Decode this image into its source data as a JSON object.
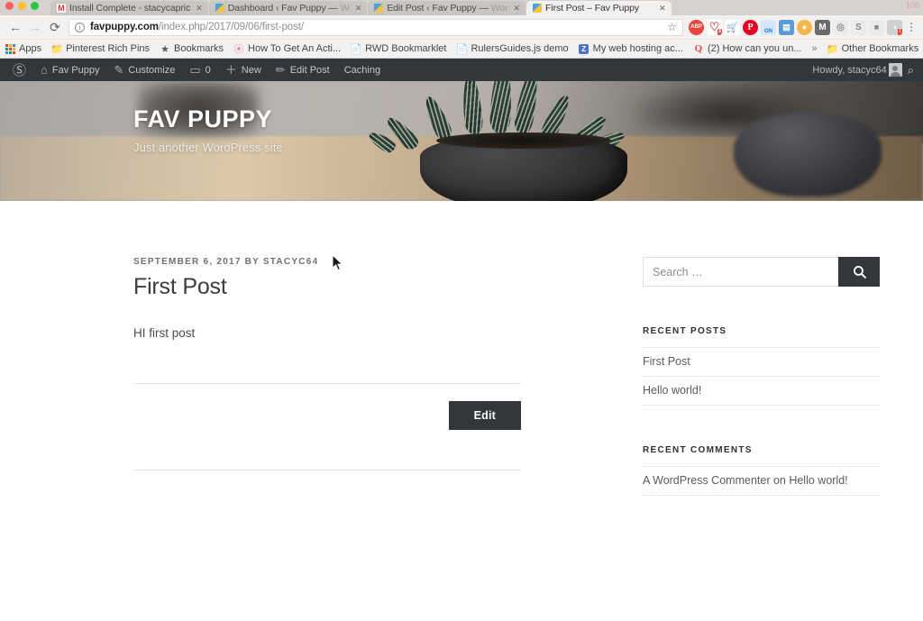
{
  "browser": {
    "tabs": [
      {
        "title": "Install Complete - stacycapric",
        "title_dim": "",
        "favicon": "gmail-icon",
        "active": false
      },
      {
        "title": "Dashboard ‹ Fav Puppy — ",
        "title_dim": "Wo",
        "favicon": "wordpress-icon",
        "active": false
      },
      {
        "title": "Edit Post ‹ Fav Puppy — ",
        "title_dim": "Wor",
        "favicon": "wordpress-icon",
        "active": false
      },
      {
        "title": "First Post – Fav Puppy",
        "title_dim": "",
        "favicon": "wordpress-icon",
        "active": true
      }
    ],
    "close_glyph": "✕",
    "nav": {
      "back": "←",
      "forward": "→",
      "reload": "⟳"
    },
    "omnibox": {
      "info_glyph": "i",
      "url_host": "favpuppy.com",
      "url_path": "/index.php/2017/09/06/first-post/",
      "star_glyph": "☆"
    },
    "extensions": [
      {
        "name": "adblock-icon",
        "glyph": "ABP"
      },
      {
        "name": "heart-icon",
        "glyph": "♡",
        "badge": "3"
      },
      {
        "name": "cart-icon",
        "glyph": "🛒"
      },
      {
        "name": "pinterest-icon",
        "glyph": "P"
      },
      {
        "name": "printer-on-icon",
        "glyph": "ON"
      },
      {
        "name": "blue-tab-icon",
        "glyph": "▤"
      },
      {
        "name": "cookie-icon",
        "glyph": "●"
      },
      {
        "name": "mailtrack-icon",
        "glyph": "M"
      },
      {
        "name": "camera-icon",
        "glyph": "◎"
      },
      {
        "name": "skype-icon",
        "glyph": "S"
      },
      {
        "name": "lastpass-icon",
        "glyph": "■"
      },
      {
        "name": "notification-icon",
        "glyph": "◑",
        "badge": "!"
      }
    ],
    "menu_glyph": "⋮",
    "bookmarks": [
      {
        "label": "Apps",
        "icon": "apps-grid-icon"
      },
      {
        "label": "Pinterest Rich Pins",
        "icon": "folder-icon"
      },
      {
        "label": "Bookmarks",
        "icon": "star-icon"
      },
      {
        "label": "How To Get An Acti...",
        "icon": "swirl-icon"
      },
      {
        "label": "RWD Bookmarklet",
        "icon": "page-icon"
      },
      {
        "label": "RulersGuides.js demo",
        "icon": "page-icon"
      },
      {
        "label": "My web hosting ac...",
        "icon": "zoho-icon"
      },
      {
        "label": "(2) How can you un...",
        "icon": "quora-icon"
      }
    ],
    "bookmarks_overflow_glyph": "»",
    "other_bookmarks": {
      "label": "Other Bookmarks",
      "icon": "folder-icon"
    },
    "tabstrip_right_note": "100"
  },
  "adminbar": {
    "logo": "wordpress-logo-icon",
    "items": [
      {
        "label": "Fav Puppy",
        "icon": "house-icon",
        "glyph": "⌂"
      },
      {
        "label": "Customize",
        "icon": "paintbrush-icon",
        "glyph": "✎"
      },
      {
        "label": "0",
        "icon": "comment-bubble-icon",
        "glyph": "▭"
      },
      {
        "label": "New",
        "icon": "plus-icon",
        "glyph": "＋"
      },
      {
        "label": "Edit Post",
        "icon": "pencil-icon",
        "glyph": "✏"
      },
      {
        "label": "Caching",
        "icon": "",
        "glyph": ""
      }
    ],
    "howdy": "Howdy, stacyc64",
    "search_glyph": "⌕"
  },
  "site": {
    "title": "FAV PUPPY",
    "description": "Just another WordPress site"
  },
  "post": {
    "meta": "SEPTEMBER 6, 2017 BY STACYC64",
    "title": "First Post",
    "body": "HI first post",
    "edit_label": "Edit"
  },
  "sidebar": {
    "search": {
      "placeholder": "Search …",
      "value": "",
      "button_icon": "search-icon"
    },
    "recent_posts": {
      "title": "RECENT POSTS",
      "items": [
        {
          "label": "First Post"
        },
        {
          "label": "Hello world!"
        }
      ]
    },
    "recent_comments": {
      "title": "RECENT COMMENTS",
      "items": [
        {
          "label": "A WordPress Commenter on Hello world!"
        }
      ]
    }
  },
  "colors": {
    "admin_bar": "#32373c",
    "button_dark": "#33373b",
    "text_body": "#4b4b4b",
    "rule": "#e4e4e4"
  }
}
